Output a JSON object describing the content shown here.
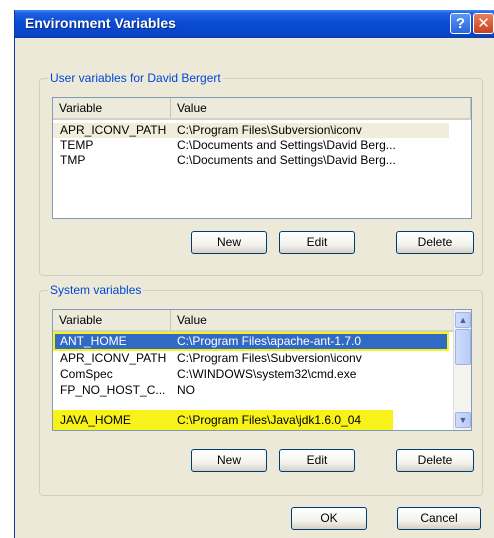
{
  "window": {
    "title": "Environment Variables"
  },
  "titlebar_buttons": {
    "help": "?",
    "close": "✕"
  },
  "user_section": {
    "legend": "User variables for David Bergert",
    "columns": [
      "Variable",
      "Value"
    ],
    "rows": [
      {
        "variable": "APR_ICONV_PATH",
        "value": "C:\\Program Files\\Subversion\\iconv"
      },
      {
        "variable": "TEMP",
        "value": "C:\\Documents and Settings\\David Berg..."
      },
      {
        "variable": "TMP",
        "value": "C:\\Documents and Settings\\David Berg..."
      }
    ],
    "buttons": {
      "new": "New",
      "edit": "Edit",
      "delete": "Delete"
    }
  },
  "system_section": {
    "legend": "System variables",
    "columns": [
      "Variable",
      "Value"
    ],
    "rows": [
      {
        "variable": "ANT_HOME",
        "value": "C:\\Program Files\\apache-ant-1.7.0"
      },
      {
        "variable": "APR_ICONV_PATH",
        "value": "C:\\Program Files\\Subversion\\iconv"
      },
      {
        "variable": "ComSpec",
        "value": "C:\\WINDOWS\\system32\\cmd.exe"
      },
      {
        "variable": "FP_NO_HOST_C...",
        "value": "NO"
      },
      {
        "variable": "JAVA_HOME",
        "value": "C:\\Program Files\\Java\\jdk1.6.0_04"
      }
    ],
    "buttons": {
      "new": "New",
      "edit": "Edit",
      "delete": "Delete"
    }
  },
  "dialog_buttons": {
    "ok": "OK",
    "cancel": "Cancel"
  },
  "scroll_arrows": {
    "up": "▲",
    "down": "▼"
  },
  "colors": {
    "titlebar": "#0a4ad4",
    "selection": "#316ac5",
    "highlight_marker": "#f6f21a",
    "legend_text": "#0046d5"
  }
}
